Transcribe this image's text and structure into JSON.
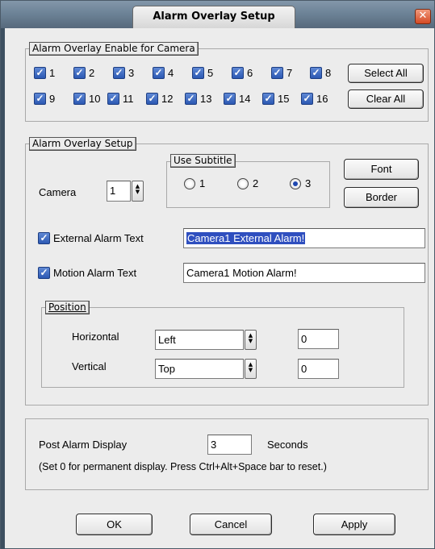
{
  "window": {
    "title": "Alarm Overlay Setup",
    "close_glyph": "✕"
  },
  "enable_group": {
    "legend": "Alarm Overlay Enable for Camera",
    "cameras": [
      "1",
      "2",
      "3",
      "4",
      "5",
      "6",
      "7",
      "8",
      "9",
      "10",
      "11",
      "12",
      "13",
      "14",
      "15",
      "16"
    ],
    "select_all": "Select All",
    "clear_all": "Clear All"
  },
  "setup_group": {
    "legend": "Alarm Overlay Setup",
    "camera_label": "Camera",
    "camera_value": "1",
    "subtitle": {
      "legend": "Use Subtitle",
      "options": [
        "1",
        "2",
        "3"
      ],
      "selected": "3"
    },
    "font_button": "Font",
    "border_button": "Border",
    "external_label": "External Alarm Text",
    "external_value": "Camera1 External Alarm!",
    "motion_label": "Motion Alarm Text",
    "motion_value": "Camera1 Motion Alarm!",
    "position": {
      "legend": "Position",
      "horizontal_label": "Horizontal",
      "horizontal_value": "Left",
      "horizontal_offset": "0",
      "vertical_label": "Vertical",
      "vertical_value": "Top",
      "vertical_offset": "0"
    }
  },
  "post_alarm": {
    "label": "Post Alarm Display",
    "value": "3",
    "unit": "Seconds",
    "note": "(Set 0 for permanent display.  Press Ctrl+Alt+Space bar to reset.)"
  },
  "footer": {
    "ok": "OK",
    "cancel": "Cancel",
    "apply": "Apply"
  },
  "colors": {
    "accent": "#2c59b3",
    "titlebar": "#6d8397",
    "close": "#d44a24"
  }
}
